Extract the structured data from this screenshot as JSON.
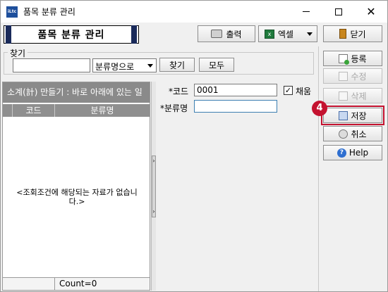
{
  "window": {
    "title": "품목 분류 관리",
    "app_icon_text": "iLtc",
    "icons": {
      "minimize": "minimize-icon",
      "maximize": "maximize-icon",
      "close": "close-icon"
    }
  },
  "header": {
    "title": "품목 분류 관리",
    "print_label": "출력",
    "excel_label": "엑셀",
    "close_label": "닫기"
  },
  "search": {
    "legend": "찾기",
    "keyword_value": "",
    "mode_selected": "분류명으로",
    "find_label": "찾기",
    "all_label": "모두"
  },
  "grid": {
    "marquee": "소계(計) 만들기 : 바로 아래에 있는 일",
    "columns": [
      "코드",
      "분류명"
    ],
    "empty_message": "<조회조건에 해당되는 자료가 없습니다.>",
    "footer_count": "Count=0"
  },
  "form": {
    "code_label": "*코드",
    "code_value": "0001",
    "auto_label": "채움",
    "auto_checked": true,
    "name_label": "*분류명",
    "name_value": ""
  },
  "actions": {
    "new_label": "등록",
    "edit_label": "수정",
    "delete_label": "삭제",
    "save_label": "저장",
    "cancel_label": "취소",
    "help_label": "Help"
  },
  "annotation": {
    "step_number": "4",
    "color": "#c4122f"
  }
}
